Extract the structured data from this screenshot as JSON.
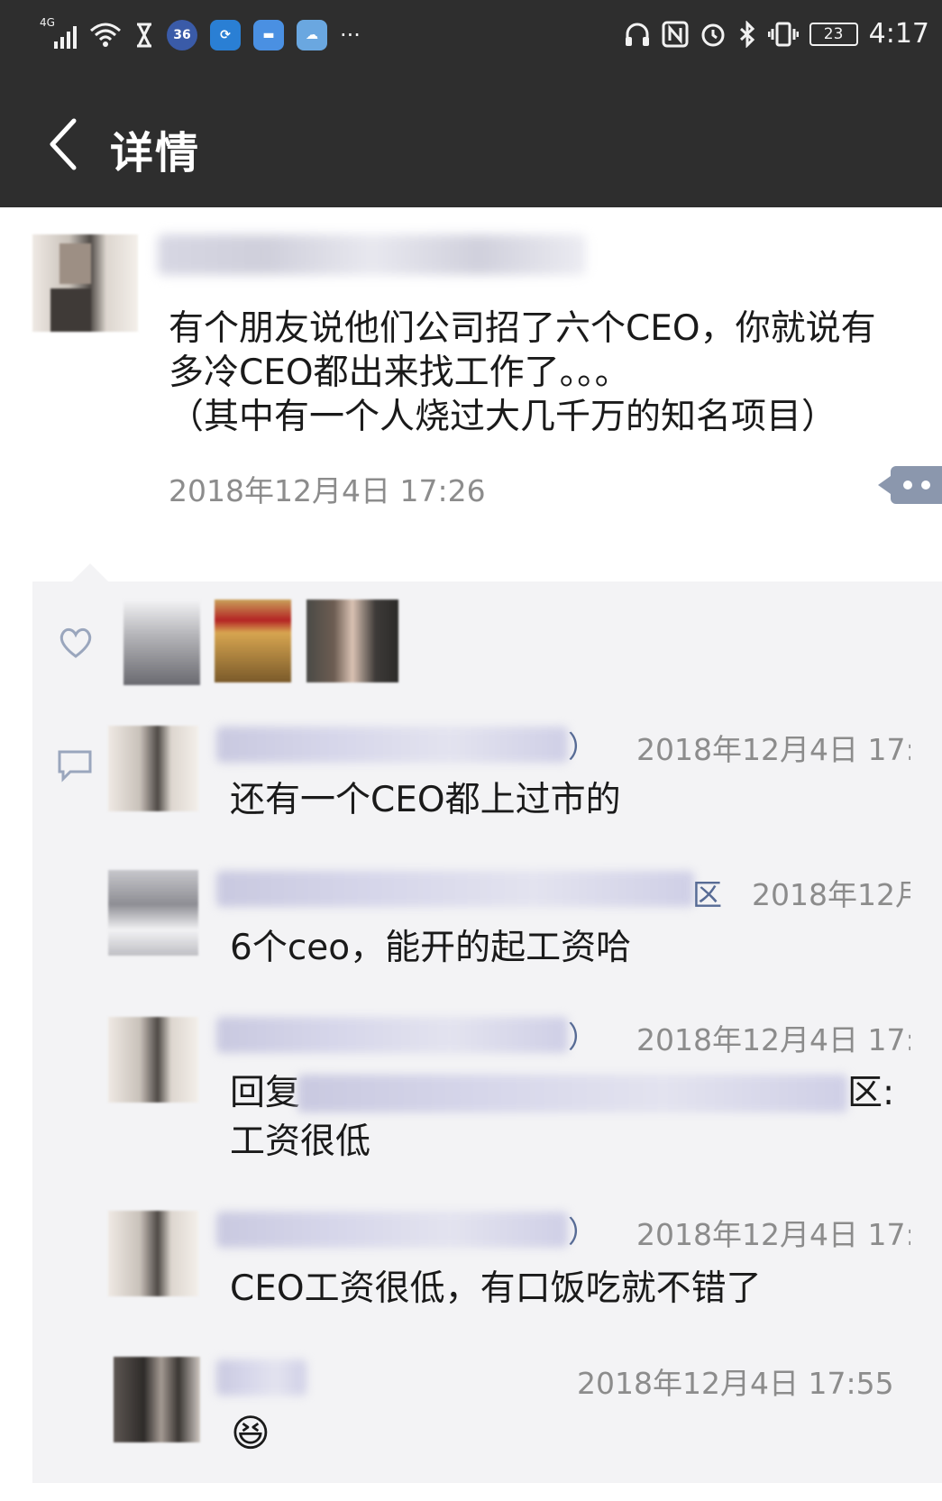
{
  "status_bar": {
    "network": "4G",
    "clock": "4:17",
    "battery": "23",
    "overflow": "···"
  },
  "header": {
    "title": "详情"
  },
  "post": {
    "text_line1": "有个朋友说他们公司招了六个CEO，你就说有",
    "text_line2": "多冷CEO都出来找工作了。。。",
    "text_line3": "（其中有一个人烧过大几千万的知名项目）",
    "timestamp": "2018年12月4日 17:26"
  },
  "comments": [
    {
      "name_suffix": "）",
      "time": "2018年12月4日 17:",
      "text": "还有一个CEO都上过市的"
    },
    {
      "name_suffix": "区",
      "time": "2018年12月",
      "text": "6个ceo，能开的起工资哈"
    },
    {
      "name_suffix": "）",
      "time": "2018年12月4日 17:",
      "reply_prefix": "回复",
      "reply_suffix": "区:",
      "text": "工资很低"
    },
    {
      "name_suffix": "）",
      "time": "2018年12月4日 17:",
      "text": "CEO工资很低，有口饭吃就不错了"
    },
    {
      "name_suffix": "",
      "time": "2018年12月4日 17:55",
      "text": "😆"
    }
  ]
}
